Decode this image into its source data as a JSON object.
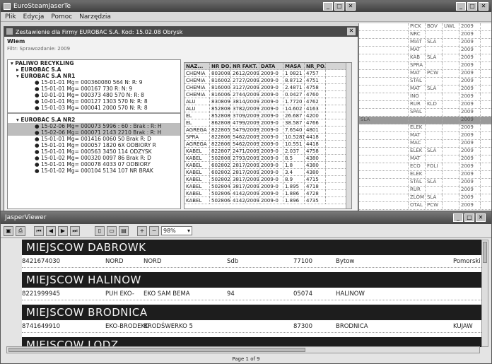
{
  "main_window": {
    "title": "EuroSteamJaserTe",
    "menu": [
      "Plik",
      "Edycja",
      "Pomoc",
      "Narzędzia"
    ]
  },
  "dialog": {
    "title": "Zestawienie dla Firmy EUROBAC S.A. Kod: 15.02.08 Obrysk",
    "label": "Wiem",
    "subtitle": "Filtr: Sprawozdanie: 2009",
    "tree": {
      "root1": "PALIWO RECYKLING",
      "child1": "EUROBAC S.A",
      "child2": "EUROBAC S.A NR1",
      "leaves1": [
        "15-01-01 Mg= 000360080 564 N: R: 9",
        "15-01-01 Mg= 000167 730 R: N: 9",
        "10-01-01 Mg= 000373 480 570 N: R: 8",
        "10-01-01 Mg= 000127 1303 570 N: R: 8",
        "15-01-03 Mg= 000041 2000 570 N: R: 8"
      ],
      "root2": "EUROBAC S.A NR2",
      "leaves2": [
        "15-02-06 Mg= 000073 5996 : 60 : Brak : R: H",
        "15-02-06 Mg= 000071 2143 2210 Brak : R: H",
        "15-01-01 Mg= 001416 0060 50 Brak R: D",
        "15-01-01 Mg= 000057 1820 6X ODBIORY R",
        "15-01-01 Mg= 000563 3450 114 ODZYSK",
        "15-01-02 Mg= 000320 0097 86 Brak R: D",
        "15-01-01 Mg= 000078 4033 07 ODBIORY",
        "15-01-02 Mg= 000104 5134 107 NR BRAK"
      ]
    },
    "table": {
      "headers": [
        "NAZ...",
        "NR DO...",
        "NR FAKT.",
        "DATA",
        "MASA",
        "NR_PO..."
      ],
      "rows": [
        [
          "CHEMIA",
          "803008",
          "2612/2009",
          "2009-0",
          "1 0821",
          "4757"
        ],
        [
          "CHEMIA",
          "816002",
          "2727/2009",
          "2009-0",
          "8.8712",
          "4751"
        ],
        [
          "CHEMIA",
          "816000",
          "3127/2009",
          "2009-0",
          "2.4871",
          "4758"
        ],
        [
          "CHEMIA",
          "816006",
          "2744/2009",
          "2009-0",
          "0.0427",
          "4760"
        ],
        [
          "ALU",
          "830809",
          "3814/2009",
          "2009-0",
          "1.7720",
          "4762"
        ],
        [
          "ALU",
          "852808",
          "3782/2009",
          "2009-0",
          "14.602",
          "4163"
        ],
        [
          "EL",
          "852808",
          "3709/2009",
          "2009-0",
          "26.687",
          "4200"
        ],
        [
          "EL",
          "862808",
          "4799/2009",
          "2009-0",
          "38.587",
          "4766"
        ],
        [
          "AGREGA",
          "822805",
          "5479/2009",
          "2009-0",
          "7.6540",
          "4801"
        ],
        [
          "SPRA",
          "822806",
          "5462/2009",
          "2009-0",
          "10.5281",
          "4418"
        ],
        [
          "AGREGA",
          "822806",
          "5462/2009",
          "2009-0",
          "10.551",
          "4418"
        ],
        [
          "KABEL",
          "822807",
          "2471/2009",
          "2009-0",
          "2.037",
          "4758"
        ],
        [
          "KABEL",
          "502808",
          "2793/2009",
          "2009-0",
          "8.5",
          "4380"
        ],
        [
          "KABEL",
          "602802",
          "2817/2009",
          "2009-0",
          "1.8",
          "4380"
        ],
        [
          "KABEL",
          "602802",
          "2817/2009",
          "2009-0",
          "3.4",
          "4380"
        ],
        [
          "KABEL",
          "502802",
          "3817/2009",
          "2009-0",
          "8.9",
          "4715"
        ],
        [
          "KABEL",
          "502804",
          "3817/2009",
          "2009-0",
          "1.895",
          "4718"
        ],
        [
          "KABEL",
          "502806",
          "4142/2009",
          "2009-0",
          "1.886",
          "4728"
        ],
        [
          "KABEL",
          "502806",
          "4142/2009",
          "2009-0",
          "1.896",
          "4735"
        ]
      ]
    }
  },
  "background_grid": {
    "rows": [
      [
        "",
        "PICK",
        "BOV",
        "UWL",
        "2009"
      ],
      [
        "",
        "NRC",
        "",
        "",
        "2009"
      ],
      [
        "",
        "MIAT",
        "SLA",
        "",
        "2009"
      ],
      [
        "",
        "MAT",
        "",
        "",
        "2009"
      ],
      [
        "",
        "KAB",
        "SLA",
        "",
        "2009"
      ],
      [
        "",
        "SPRA",
        "",
        "",
        "2009"
      ],
      [
        "",
        "MAT",
        "PCW",
        "",
        "2009"
      ],
      [
        "",
        "STAL",
        "",
        "",
        "2009"
      ],
      [
        "",
        "MAT",
        "SLA",
        "",
        "2009"
      ],
      [
        "",
        "INO",
        "",
        "",
        "2009"
      ],
      [
        "",
        "RUR",
        "KLD",
        "",
        "2009"
      ],
      [
        "",
        "SPAL",
        "",
        "",
        "2009"
      ],
      [
        "SLA",
        "",
        "",
        "",
        "2009"
      ],
      [
        "",
        "ELEK",
        "",
        "",
        "2009"
      ],
      [
        "",
        "MAT",
        "",
        "",
        "2009"
      ],
      [
        "",
        "MAC",
        "",
        "",
        "2009"
      ],
      [
        "",
        "ELEK",
        "SLA",
        "",
        "2009"
      ],
      [
        "",
        "MAT",
        "",
        "",
        "2009"
      ],
      [
        "",
        "ECO",
        "FOLI",
        "",
        "2009"
      ],
      [
        "",
        "ELEK",
        "",
        "",
        "2009"
      ],
      [
        "",
        "STAL",
        "SLA",
        "",
        "2009"
      ],
      [
        "",
        "RUR",
        "",
        "",
        "2009"
      ],
      [
        "",
        "ZLOM",
        "SLA",
        "",
        "2009"
      ],
      [
        "",
        "OTAL",
        "PCW",
        "",
        "2009"
      ]
    ]
  },
  "viewer": {
    "title": "JasperViewer",
    "zoom": "98%",
    "groups": [
      {
        "header": "MIEJSCOW  DABROWK",
        "row": {
          "nip": "8421674030",
          "name1": "NORD",
          "name2": "NORD",
          "street": "Sdb",
          "zip": "77100",
          "city": "Bytow",
          "region": "Pomorski"
        }
      },
      {
        "header": "MIEJSCOW  HALINOW",
        "row": {
          "nip": "8221999945",
          "name1": "PUH EKO-",
          "name2": "EKO SAM  BEMA",
          "street": "94",
          "zip": "05074",
          "city": "HALINOW",
          "region": ""
        }
      },
      {
        "header": "MIEJSCOW  BRODNICA",
        "row": {
          "nip": "8741649910",
          "name1": "EKO-BRODEKO",
          "name2": "BRODŚWERKO  5",
          "street": "",
          "zip": "87300",
          "city": "BRODNICA",
          "region": "KUJAW"
        }
      },
      {
        "header": "MIEJSCOW  LODZ",
        "row": {
          "nip": "",
          "name1": "",
          "name2": "",
          "street": "",
          "zip": "",
          "city": "",
          "region": ""
        }
      }
    ],
    "page_label": "Page 1 of 9"
  }
}
